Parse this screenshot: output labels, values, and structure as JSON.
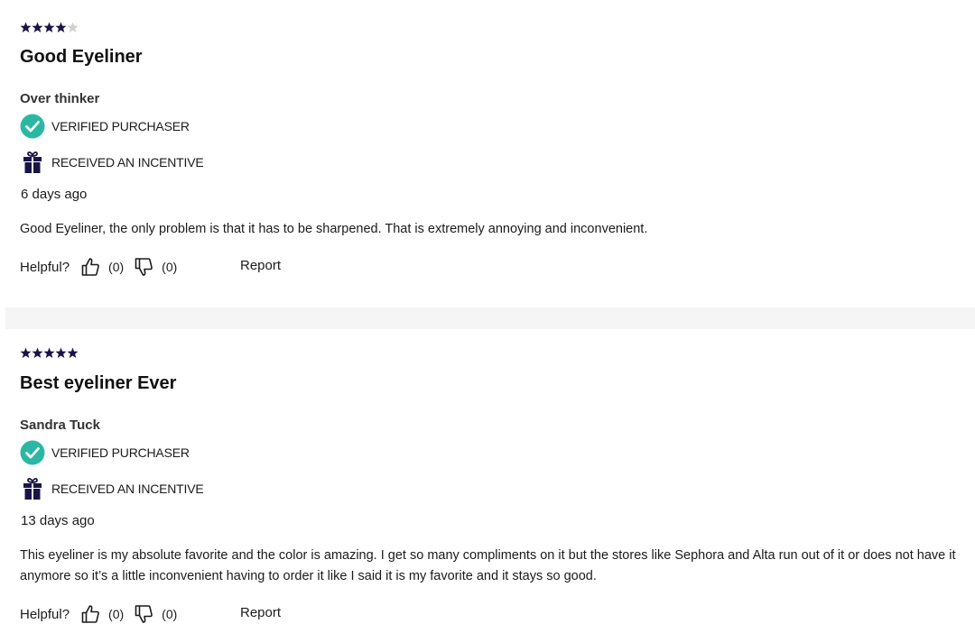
{
  "reviews": [
    {
      "rating": 4,
      "max_rating": 5,
      "title": "Good Eyeliner",
      "author": "Over thinker",
      "verified_label": "VERIFIED PURCHASER",
      "incentive_label": "RECEIVED AN INCENTIVE",
      "date": "6 days ago",
      "body": "Good Eyeliner, the only problem is that it has to be sharpened. That is extremely annoying and inconvenient.",
      "helpful_label": "Helpful?",
      "upvotes": "(0)",
      "downvotes": "(0)",
      "report_label": "Report"
    },
    {
      "rating": 5,
      "max_rating": 5,
      "title": "Best eyeliner Ever",
      "author": "Sandra Tuck",
      "verified_label": "VERIFIED PURCHASER",
      "incentive_label": "RECEIVED AN INCENTIVE",
      "date": "13 days ago",
      "body": "This eyeliner is my absolute favorite and the color is amazing. I get so many compliments on it but the stores like Sephora and Alta run out of it or does not have it anymore so it’s a little inconvenient having to order it like I said it is my favorite and it stays so good.",
      "helpful_label": "Helpful?",
      "upvotes": "(0)",
      "downvotes": "(0)",
      "report_label": "Report"
    }
  ],
  "colors": {
    "star_filled": "#1a1446",
    "star_empty": "#d0d0d0",
    "verified_badge": "#2bb8a3",
    "gift_icon": "#1a1446",
    "divider": "#f5f5f5"
  },
  "icons": {
    "verified": "check-circle-icon",
    "incentive": "gift-icon",
    "upvote": "thumbs-up-icon",
    "downvote": "thumbs-down-icon",
    "star": "star-icon"
  }
}
